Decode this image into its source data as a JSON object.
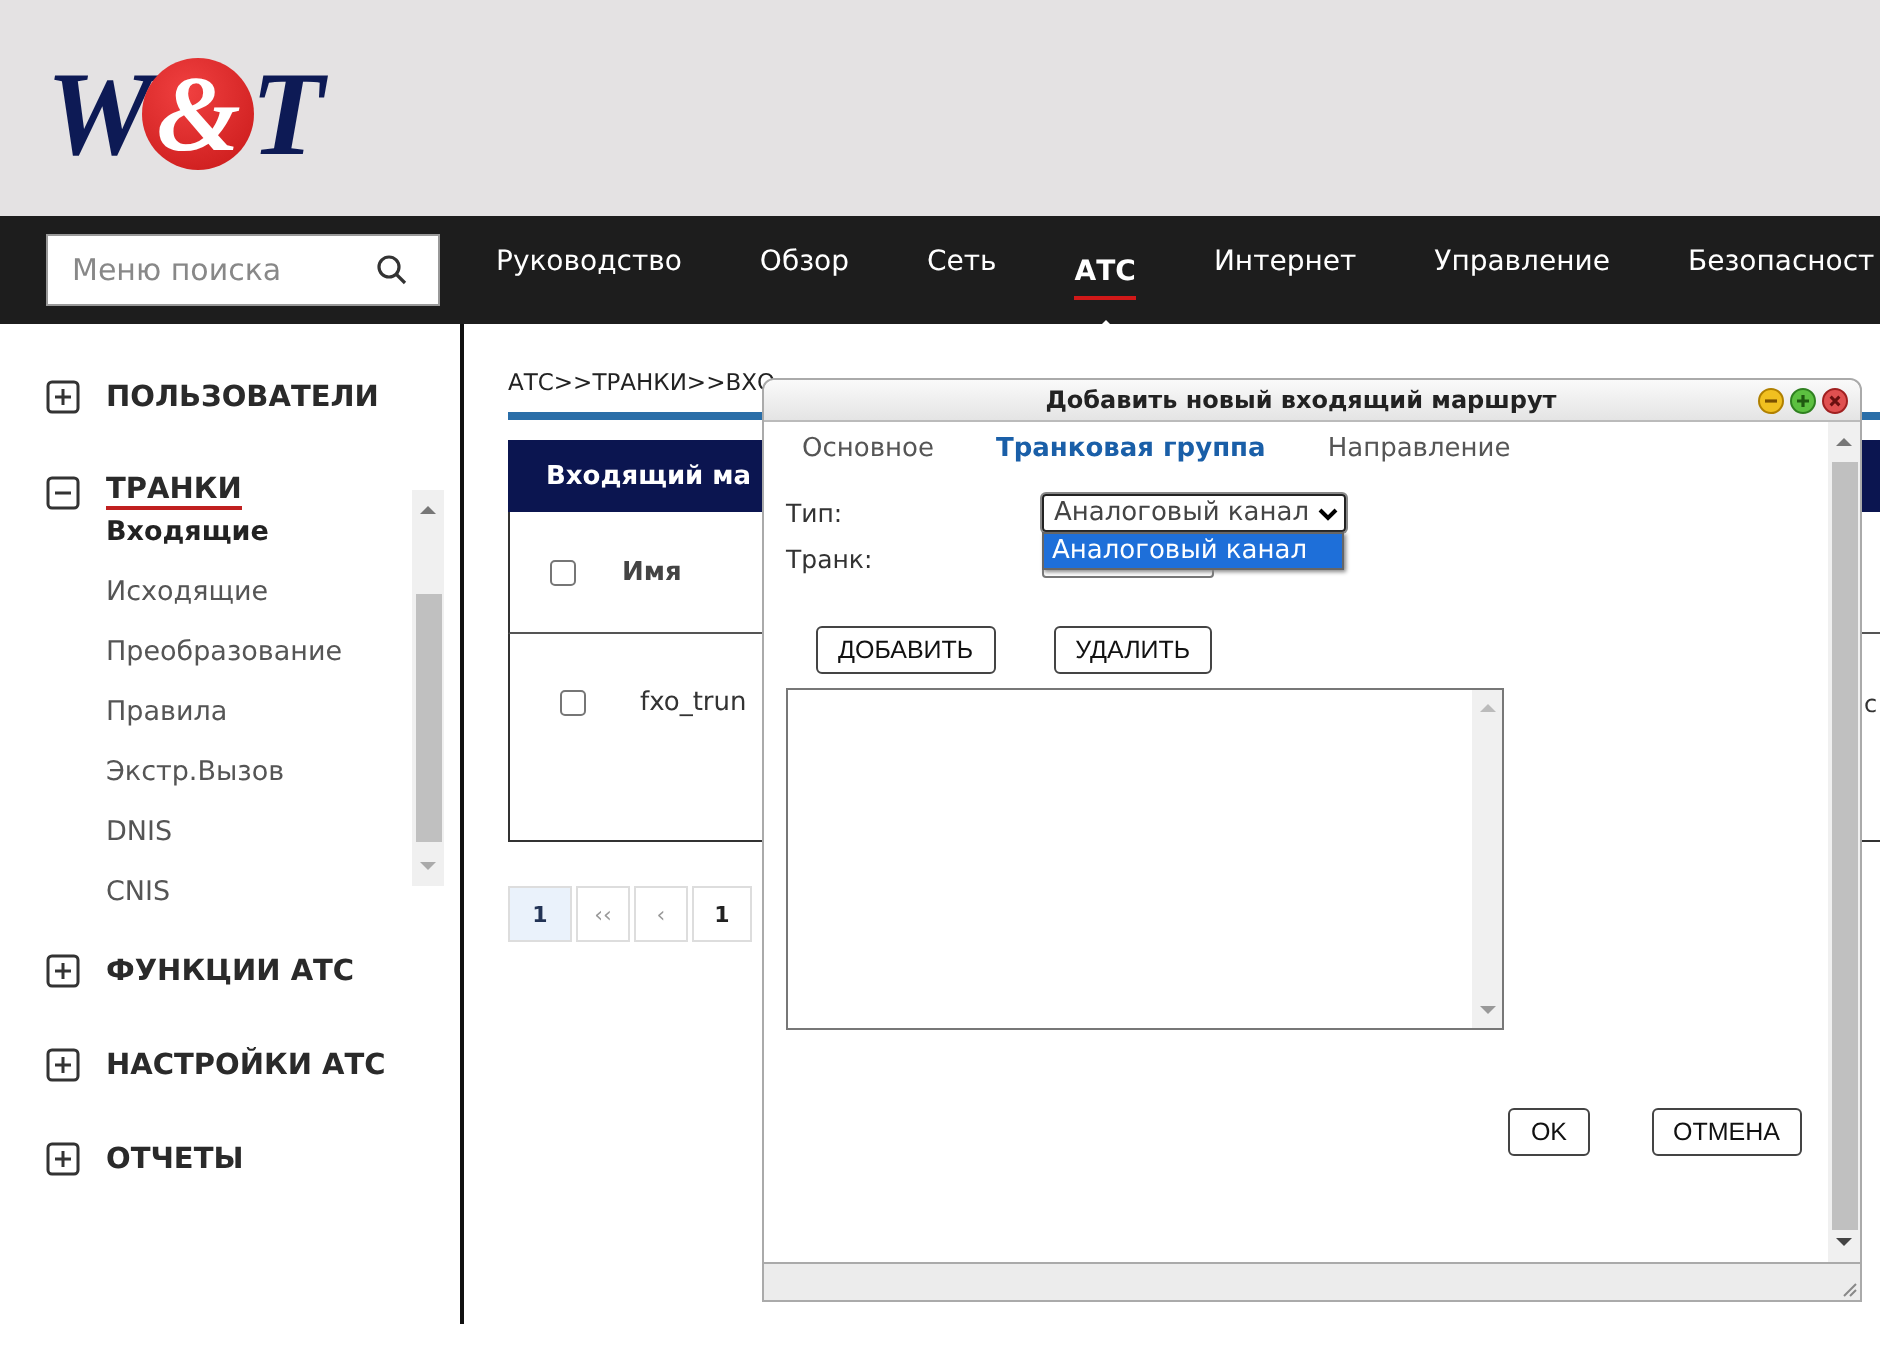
{
  "logo": {
    "first": "W",
    "amp": "&",
    "last": "T"
  },
  "search": {
    "placeholder": "Меню поиска"
  },
  "nav": [
    {
      "label": "Руководство",
      "selected": false
    },
    {
      "label": "Обзор",
      "selected": false
    },
    {
      "label": "Сеть",
      "selected": false
    },
    {
      "label": "АТС",
      "selected": true
    },
    {
      "label": "Интернет",
      "selected": false
    },
    {
      "label": "Управление",
      "selected": false
    },
    {
      "label": "Безопасност",
      "selected": false
    }
  ],
  "sidebar": [
    {
      "label": "ПОЛЬЗОВАТЕЛИ",
      "expanded": false
    },
    {
      "label": "ТРАНКИ",
      "expanded": true,
      "children": [
        {
          "label": "Входящие",
          "selected": true
        },
        {
          "label": "Исходящие",
          "selected": false
        },
        {
          "label": "Преобразование",
          "selected": false
        },
        {
          "label": "Правила",
          "selected": false
        },
        {
          "label": "Экстр.Вызов",
          "selected": false
        },
        {
          "label": "DNIS",
          "selected": false
        },
        {
          "label": "CNIS",
          "selected": false
        }
      ]
    },
    {
      "label": "ФУНКЦИИ АТС",
      "expanded": false
    },
    {
      "label": "НАСТРОЙКИ АТС",
      "expanded": false
    },
    {
      "label": "ОТЧЕТЫ",
      "expanded": false
    }
  ],
  "breadcrumb": "АТС>>ТРАНКИ>>ВХО",
  "table": {
    "title": "Входящий ма",
    "header_checked": false,
    "column": "Имя",
    "rows": [
      {
        "checked": false,
        "cells": [
          "fxo_trun",
          "с"
        ]
      }
    ]
  },
  "pagination": [
    {
      "label": "1",
      "kind": "current"
    },
    {
      "label": "‹‹",
      "kind": "nav"
    },
    {
      "label": "‹",
      "kind": "nav"
    },
    {
      "label": "1",
      "kind": "page"
    }
  ],
  "dialog": {
    "title": "Добавить новый входящий маршрут",
    "tabs": [
      {
        "label": "Основное",
        "selected": false
      },
      {
        "label": "Транковая группа",
        "selected": true
      },
      {
        "label": "Направление",
        "selected": false
      }
    ],
    "fields": [
      {
        "label": "Тип:",
        "value": "Аналоговый канал",
        "expanded": true,
        "options": [
          {
            "label": "Аналоговый канал",
            "selected": true
          }
        ]
      },
      {
        "label": "Транк:",
        "expanded": false
      }
    ],
    "list_buttons": [
      "ДОБАВИТЬ",
      "УДАЛИТЬ"
    ],
    "buttons": [
      "OK",
      "ОТМЕНА"
    ]
  }
}
